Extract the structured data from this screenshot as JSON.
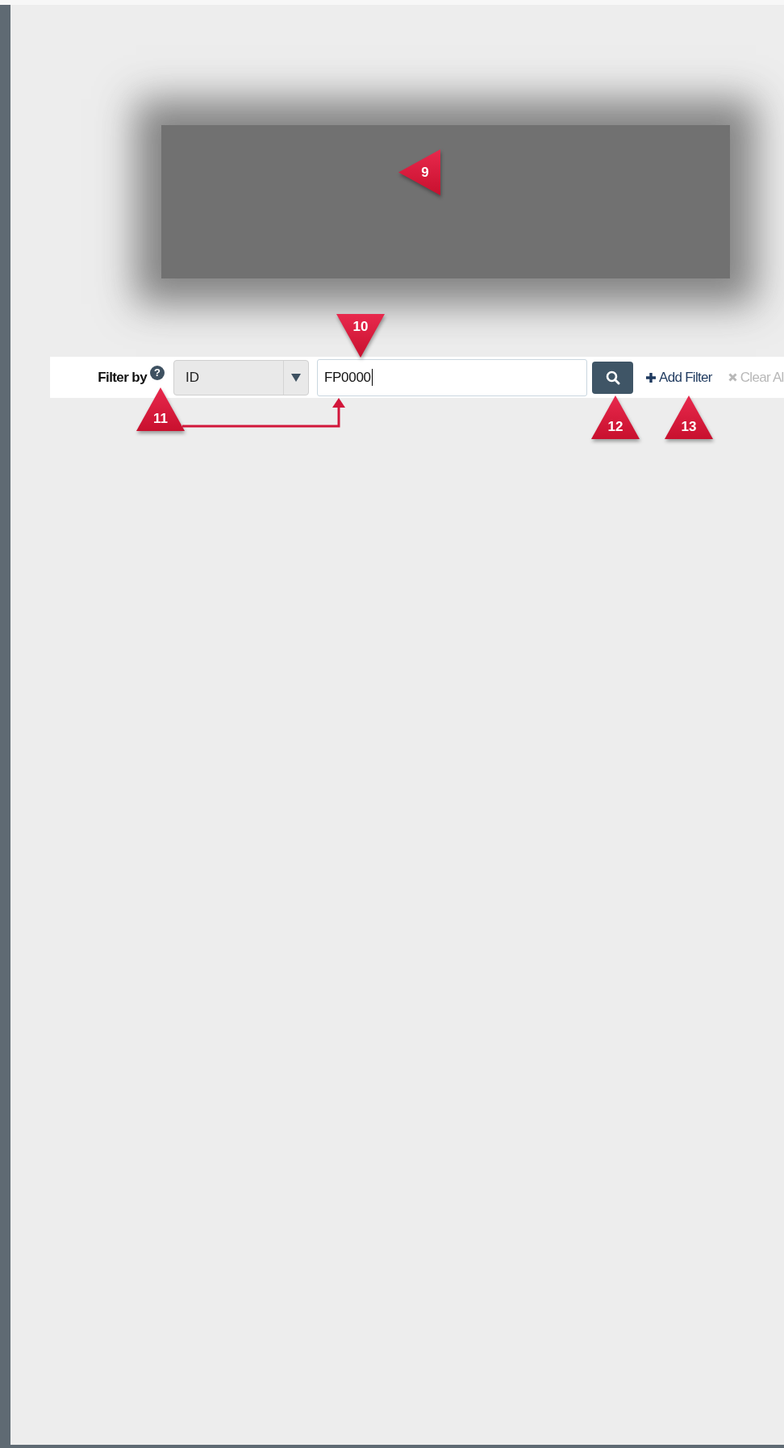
{
  "filter_bar": {
    "label": "Filter by",
    "help": "?",
    "field_select": {
      "value": "ID"
    },
    "search_input": {
      "value": "FP0000",
      "focused": true
    },
    "add_filter": {
      "label": "Add Filter"
    },
    "clear_all": {
      "label": "Clear Al",
      "disabled": true
    }
  },
  "callouts": [
    {
      "number": "9",
      "kind": "left"
    },
    {
      "number": "10",
      "kind": "down"
    },
    {
      "number": "11",
      "kind": "up"
    },
    {
      "number": "12",
      "kind": "up"
    },
    {
      "number": "13",
      "kind": "up"
    }
  ]
}
